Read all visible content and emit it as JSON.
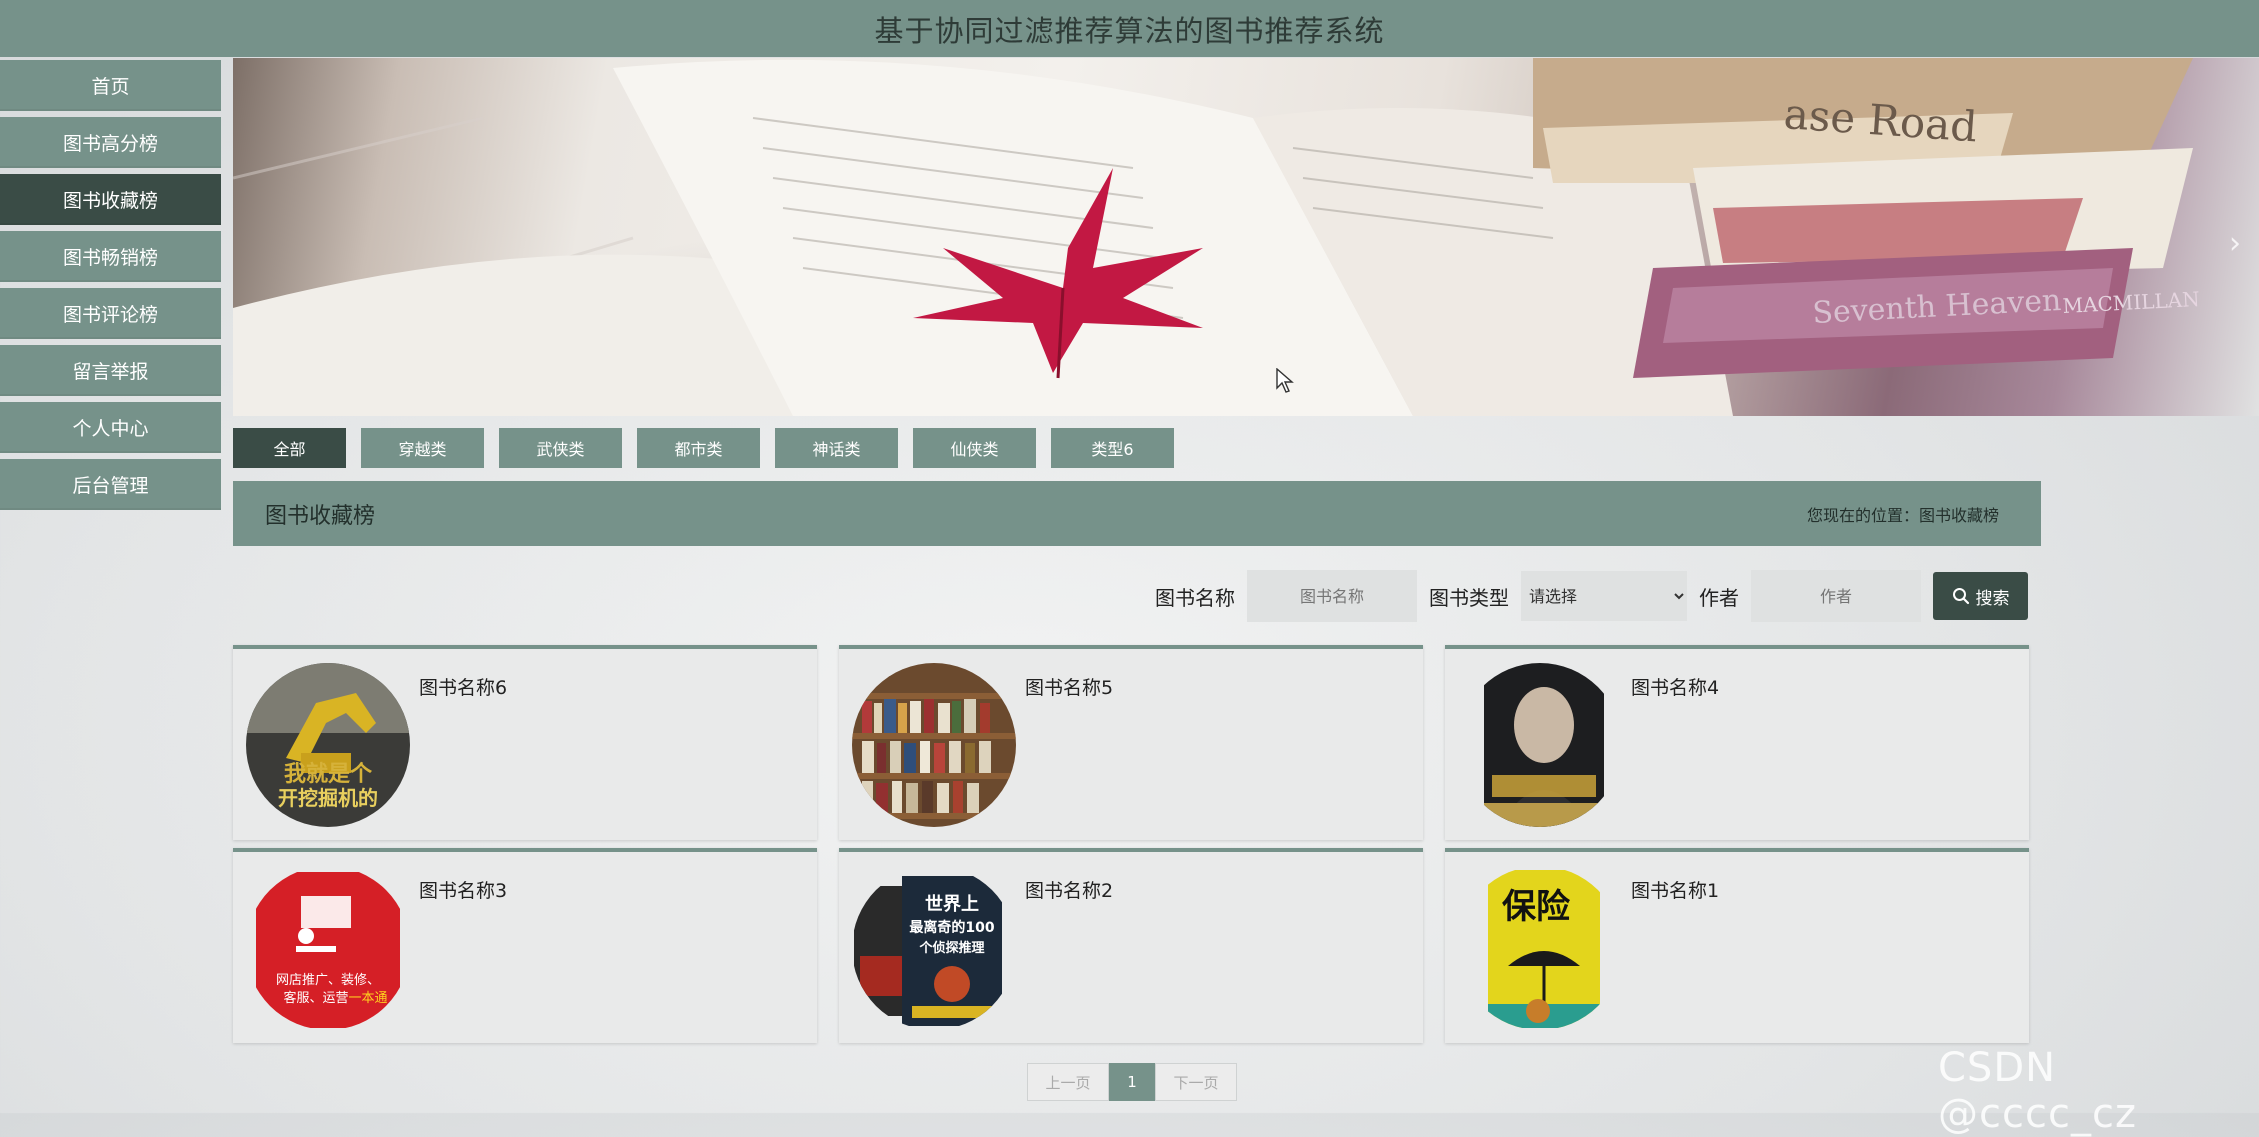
{
  "header": {
    "title": "基于协同过滤推荐算法的图书推荐系统"
  },
  "sidebar": {
    "items": [
      {
        "label": "首页"
      },
      {
        "label": "图书高分榜"
      },
      {
        "label": "图书收藏榜",
        "active": true
      },
      {
        "label": "图书畅销榜"
      },
      {
        "label": "图书评论榜"
      },
      {
        "label": "留言举报"
      },
      {
        "label": "个人中心"
      },
      {
        "label": "后台管理"
      }
    ]
  },
  "banner": {
    "next_icon": "chevron-right-icon",
    "book_spine_texts": [
      "ase Road",
      "Seventh Heaven",
      "MACMILLAN"
    ]
  },
  "categories": [
    {
      "label": "全部",
      "active": true
    },
    {
      "label": "穿越类"
    },
    {
      "label": "武侠类"
    },
    {
      "label": "都市类"
    },
    {
      "label": "神话类"
    },
    {
      "label": "仙侠类"
    },
    {
      "label": "类型6"
    }
  ],
  "section": {
    "title": "图书收藏榜",
    "location_text": "您现在的位置：图书收藏榜"
  },
  "search": {
    "name_label": "图书名称",
    "name_placeholder": "图书名称",
    "type_label": "图书类型",
    "type_selected": "请选择",
    "author_label": "作者",
    "author_placeholder": "作者",
    "button_label": "搜索"
  },
  "books": [
    {
      "name": "图书名称6",
      "cover_text": [
        "我就是个",
        "开挖掘机的"
      ]
    },
    {
      "name": "图书名称5",
      "cover_text": []
    },
    {
      "name": "图书名称4",
      "cover_text": []
    },
    {
      "name": "图书名称3",
      "cover_text": [
        "网店推广、装修、",
        "客服、运营",
        "一本通"
      ]
    },
    {
      "name": "图书名称2",
      "cover_text": [
        "世界上",
        "最离奇的100",
        "个侦探推理"
      ]
    },
    {
      "name": "图书名称1",
      "cover_text": [
        "保险"
      ]
    }
  ],
  "pagination": {
    "prev": "上一页",
    "current": "1",
    "next": "下一页"
  },
  "watermark": "CSDN @cccc_cz",
  "colors": {
    "primary": "#76928a",
    "active": "#3a4c46"
  }
}
